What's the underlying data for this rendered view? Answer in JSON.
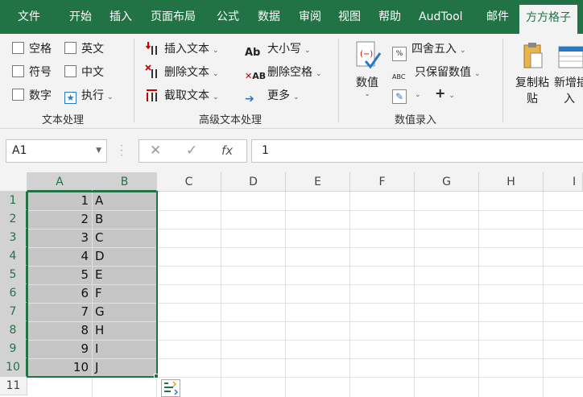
{
  "tabs": [
    "文件",
    "开始",
    "插入",
    "页面布局",
    "公式",
    "数据",
    "审阅",
    "视图",
    "帮助",
    "AudTool",
    "邮件",
    "方方格子"
  ],
  "active_tab_index": 11,
  "ribbon": {
    "text_processing": {
      "items": [
        "空格",
        "英文",
        "符号",
        "中文",
        "数字",
        "执行"
      ],
      "label": "文本处理"
    },
    "advanced_text": {
      "insert_text": "插入文本",
      "delete_text": "删除文本",
      "extract_text": "截取文本",
      "case": "大小写",
      "delete_spaces": "删除空格",
      "more": "更多",
      "label": "高级文本处理"
    },
    "numeric_input": {
      "value": "数值",
      "round": "四舍五入",
      "keep_value": "只保留数值",
      "plus": "+",
      "label": "数值录入"
    },
    "clipboard": {
      "copy_paste_line1": "复制粘",
      "copy_paste_line2": "贴",
      "new_insert_line1": "新增插",
      "new_insert_line2": "入"
    }
  },
  "formula_bar": {
    "name_box": "A1",
    "cancel": "✕",
    "confirm": "✓",
    "fx": "fx",
    "value": "1"
  },
  "columns": [
    "A",
    "B",
    "C",
    "D",
    "E",
    "F",
    "G",
    "H",
    "I"
  ],
  "rows": [
    "1",
    "2",
    "3",
    "4",
    "5",
    "6",
    "7",
    "8",
    "9",
    "10",
    "11"
  ],
  "cells": {
    "A": [
      "1",
      "2",
      "3",
      "4",
      "5",
      "6",
      "7",
      "8",
      "9",
      "10"
    ],
    "B": [
      "A",
      "B",
      "C",
      "D",
      "E",
      "F",
      "G",
      "H",
      "I",
      "J"
    ]
  },
  "selection": "A1:B10",
  "colors": {
    "accent": "#217346",
    "selection_fill": "#c6c6c6",
    "ribbon_bg": "#f3f3f3"
  }
}
